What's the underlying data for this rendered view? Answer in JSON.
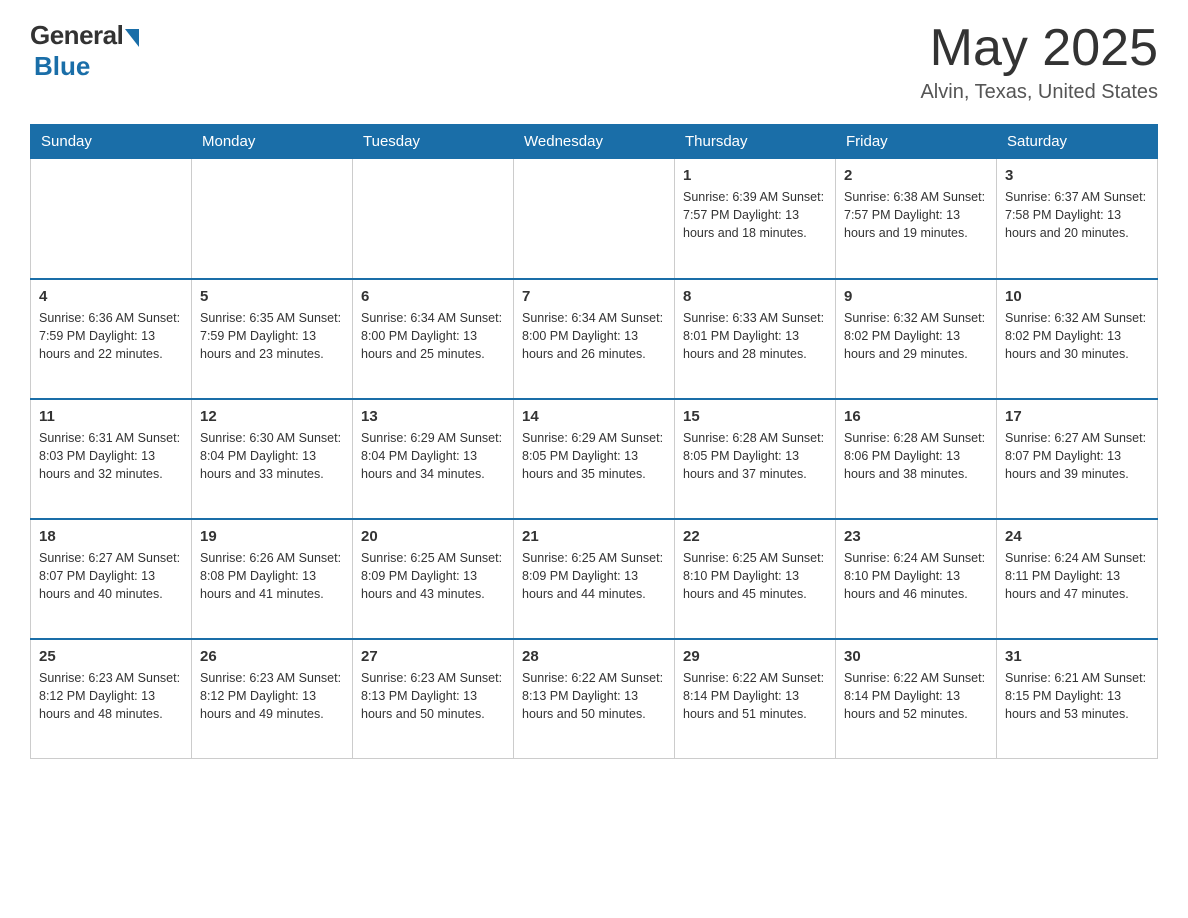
{
  "header": {
    "logo_general": "General",
    "logo_blue": "Blue",
    "title": "May 2025",
    "location": "Alvin, Texas, United States"
  },
  "days_of_week": [
    "Sunday",
    "Monday",
    "Tuesday",
    "Wednesday",
    "Thursday",
    "Friday",
    "Saturday"
  ],
  "weeks": [
    {
      "days": [
        {
          "num": "",
          "info": ""
        },
        {
          "num": "",
          "info": ""
        },
        {
          "num": "",
          "info": ""
        },
        {
          "num": "",
          "info": ""
        },
        {
          "num": "1",
          "info": "Sunrise: 6:39 AM\nSunset: 7:57 PM\nDaylight: 13 hours\nand 18 minutes."
        },
        {
          "num": "2",
          "info": "Sunrise: 6:38 AM\nSunset: 7:57 PM\nDaylight: 13 hours\nand 19 minutes."
        },
        {
          "num": "3",
          "info": "Sunrise: 6:37 AM\nSunset: 7:58 PM\nDaylight: 13 hours\nand 20 minutes."
        }
      ]
    },
    {
      "days": [
        {
          "num": "4",
          "info": "Sunrise: 6:36 AM\nSunset: 7:59 PM\nDaylight: 13 hours\nand 22 minutes."
        },
        {
          "num": "5",
          "info": "Sunrise: 6:35 AM\nSunset: 7:59 PM\nDaylight: 13 hours\nand 23 minutes."
        },
        {
          "num": "6",
          "info": "Sunrise: 6:34 AM\nSunset: 8:00 PM\nDaylight: 13 hours\nand 25 minutes."
        },
        {
          "num": "7",
          "info": "Sunrise: 6:34 AM\nSunset: 8:00 PM\nDaylight: 13 hours\nand 26 minutes."
        },
        {
          "num": "8",
          "info": "Sunrise: 6:33 AM\nSunset: 8:01 PM\nDaylight: 13 hours\nand 28 minutes."
        },
        {
          "num": "9",
          "info": "Sunrise: 6:32 AM\nSunset: 8:02 PM\nDaylight: 13 hours\nand 29 minutes."
        },
        {
          "num": "10",
          "info": "Sunrise: 6:32 AM\nSunset: 8:02 PM\nDaylight: 13 hours\nand 30 minutes."
        }
      ]
    },
    {
      "days": [
        {
          "num": "11",
          "info": "Sunrise: 6:31 AM\nSunset: 8:03 PM\nDaylight: 13 hours\nand 32 minutes."
        },
        {
          "num": "12",
          "info": "Sunrise: 6:30 AM\nSunset: 8:04 PM\nDaylight: 13 hours\nand 33 minutes."
        },
        {
          "num": "13",
          "info": "Sunrise: 6:29 AM\nSunset: 8:04 PM\nDaylight: 13 hours\nand 34 minutes."
        },
        {
          "num": "14",
          "info": "Sunrise: 6:29 AM\nSunset: 8:05 PM\nDaylight: 13 hours\nand 35 minutes."
        },
        {
          "num": "15",
          "info": "Sunrise: 6:28 AM\nSunset: 8:05 PM\nDaylight: 13 hours\nand 37 minutes."
        },
        {
          "num": "16",
          "info": "Sunrise: 6:28 AM\nSunset: 8:06 PM\nDaylight: 13 hours\nand 38 minutes."
        },
        {
          "num": "17",
          "info": "Sunrise: 6:27 AM\nSunset: 8:07 PM\nDaylight: 13 hours\nand 39 minutes."
        }
      ]
    },
    {
      "days": [
        {
          "num": "18",
          "info": "Sunrise: 6:27 AM\nSunset: 8:07 PM\nDaylight: 13 hours\nand 40 minutes."
        },
        {
          "num": "19",
          "info": "Sunrise: 6:26 AM\nSunset: 8:08 PM\nDaylight: 13 hours\nand 41 minutes."
        },
        {
          "num": "20",
          "info": "Sunrise: 6:25 AM\nSunset: 8:09 PM\nDaylight: 13 hours\nand 43 minutes."
        },
        {
          "num": "21",
          "info": "Sunrise: 6:25 AM\nSunset: 8:09 PM\nDaylight: 13 hours\nand 44 minutes."
        },
        {
          "num": "22",
          "info": "Sunrise: 6:25 AM\nSunset: 8:10 PM\nDaylight: 13 hours\nand 45 minutes."
        },
        {
          "num": "23",
          "info": "Sunrise: 6:24 AM\nSunset: 8:10 PM\nDaylight: 13 hours\nand 46 minutes."
        },
        {
          "num": "24",
          "info": "Sunrise: 6:24 AM\nSunset: 8:11 PM\nDaylight: 13 hours\nand 47 minutes."
        }
      ]
    },
    {
      "days": [
        {
          "num": "25",
          "info": "Sunrise: 6:23 AM\nSunset: 8:12 PM\nDaylight: 13 hours\nand 48 minutes."
        },
        {
          "num": "26",
          "info": "Sunrise: 6:23 AM\nSunset: 8:12 PM\nDaylight: 13 hours\nand 49 minutes."
        },
        {
          "num": "27",
          "info": "Sunrise: 6:23 AM\nSunset: 8:13 PM\nDaylight: 13 hours\nand 50 minutes."
        },
        {
          "num": "28",
          "info": "Sunrise: 6:22 AM\nSunset: 8:13 PM\nDaylight: 13 hours\nand 50 minutes."
        },
        {
          "num": "29",
          "info": "Sunrise: 6:22 AM\nSunset: 8:14 PM\nDaylight: 13 hours\nand 51 minutes."
        },
        {
          "num": "30",
          "info": "Sunrise: 6:22 AM\nSunset: 8:14 PM\nDaylight: 13 hours\nand 52 minutes."
        },
        {
          "num": "31",
          "info": "Sunrise: 6:21 AM\nSunset: 8:15 PM\nDaylight: 13 hours\nand 53 minutes."
        }
      ]
    }
  ]
}
